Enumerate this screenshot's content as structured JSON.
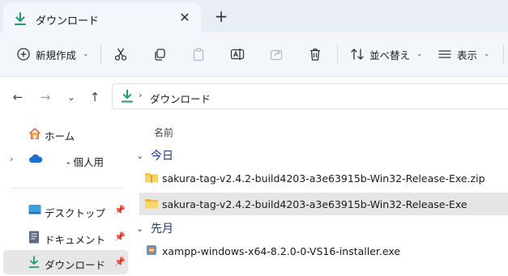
{
  "tab": {
    "title": "ダウンロード",
    "close": "✕",
    "new_tab": "+"
  },
  "commands": {
    "new": {
      "label": "新規作成",
      "chevron": "⌄"
    },
    "sort": {
      "label": "並べ替え",
      "chevron": "⌄"
    },
    "view": {
      "label": "表示",
      "chevron": "⌄"
    }
  },
  "nav": {
    "back": "←",
    "forward": "→",
    "recent": "⌄",
    "up": "↑"
  },
  "address": {
    "separator": "›",
    "path": "ダウンロード"
  },
  "sidebar": {
    "home": "ホーム",
    "onedrive": "- 個人用",
    "expander": "›",
    "pin": "📌",
    "desktop": "デスクトップ",
    "documents": "ドキュメント",
    "downloads": "ダウンロード"
  },
  "content": {
    "column_name": "名前",
    "group_chevron": "⌄",
    "groups": [
      {
        "label": "今日"
      },
      {
        "label": "先月"
      }
    ],
    "files": [
      {
        "name": "sakura-tag-v2.4.2-build4203-a3e63915b-Win32-Release-Exe.zip",
        "type": "zip"
      },
      {
        "name": "sakura-tag-v2.4.2-build4203-a3e63915b-Win32-Release-Exe",
        "type": "folder",
        "selected": true
      },
      {
        "name": "xampp-windows-x64-8.2.0-0-VS16-installer.exe",
        "type": "exe"
      }
    ]
  },
  "colors": {
    "accent_green": "#1b9e6a",
    "folder_yellow": "#f5c542",
    "group_blue": "#1a3d8f"
  }
}
